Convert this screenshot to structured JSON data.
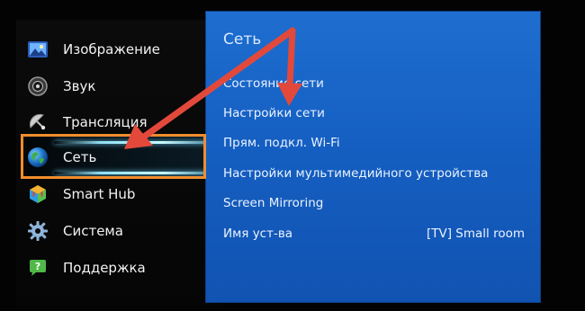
{
  "left_menu": {
    "items": [
      {
        "label": "Изображение",
        "icon": "picture-icon"
      },
      {
        "label": "Звук",
        "icon": "speaker-icon"
      },
      {
        "label": "Трансляция",
        "icon": "satellite-dish-icon"
      },
      {
        "label": "Сеть",
        "icon": "globe-icon",
        "selected": true
      },
      {
        "label": "Smart Hub",
        "icon": "smart-hub-cube-icon"
      },
      {
        "label": "Система",
        "icon": "gear-icon"
      },
      {
        "label": "Поддержка",
        "icon": "support-bubble-icon"
      }
    ]
  },
  "network_panel": {
    "title": "Сеть",
    "items": [
      {
        "label": "Состояние сети",
        "value": ""
      },
      {
        "label": "Настройки сети",
        "value": ""
      },
      {
        "label": "Прям. подкл. Wi-Fi",
        "value": ""
      },
      {
        "label": "Настройки мультимедийного устройства",
        "value": ""
      },
      {
        "label": "Screen Mirroring",
        "value": ""
      },
      {
        "label": "Имя уст-ва",
        "value": "[TV] Small room"
      }
    ]
  },
  "annotations": {
    "arrow_color": "#e2493b",
    "highlight_color": "#f08d2d"
  },
  "colors": {
    "panel_blue": "#1a66c8",
    "background": "#000000"
  }
}
